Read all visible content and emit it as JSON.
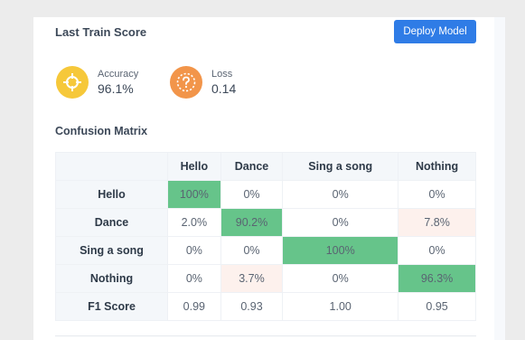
{
  "header": {
    "title": "Last Train Score",
    "deploy_label": "Deploy Model"
  },
  "metrics": {
    "accuracy": {
      "label": "Accuracy",
      "value": "96.1%",
      "icon": "crosshair-icon",
      "color": "#f6c83a"
    },
    "loss": {
      "label": "Loss",
      "value": "0.14",
      "icon": "question-icon",
      "color": "#f2954a"
    }
  },
  "matrix": {
    "title": "Confusion Matrix",
    "columns": [
      "",
      "Hello",
      "Dance",
      "Sing a song",
      "Nothing"
    ],
    "rows": [
      {
        "label": "Hello",
        "cells": [
          "100%",
          "0%",
          "0%",
          "0%"
        ]
      },
      {
        "label": "Dance",
        "cells": [
          "2.0%",
          "90.2%",
          "0%",
          "7.8%"
        ]
      },
      {
        "label": "Sing a song",
        "cells": [
          "0%",
          "0%",
          "100%",
          "0%"
        ]
      },
      {
        "label": "Nothing",
        "cells": [
          "0%",
          "3.7%",
          "0%",
          "96.3%"
        ]
      },
      {
        "label": "F1 Score",
        "cells": [
          "0.99",
          "0.93",
          "1.00",
          "0.95"
        ]
      }
    ],
    "colors": {
      "high": "#66c48a",
      "low": "#fdf1ed"
    }
  }
}
